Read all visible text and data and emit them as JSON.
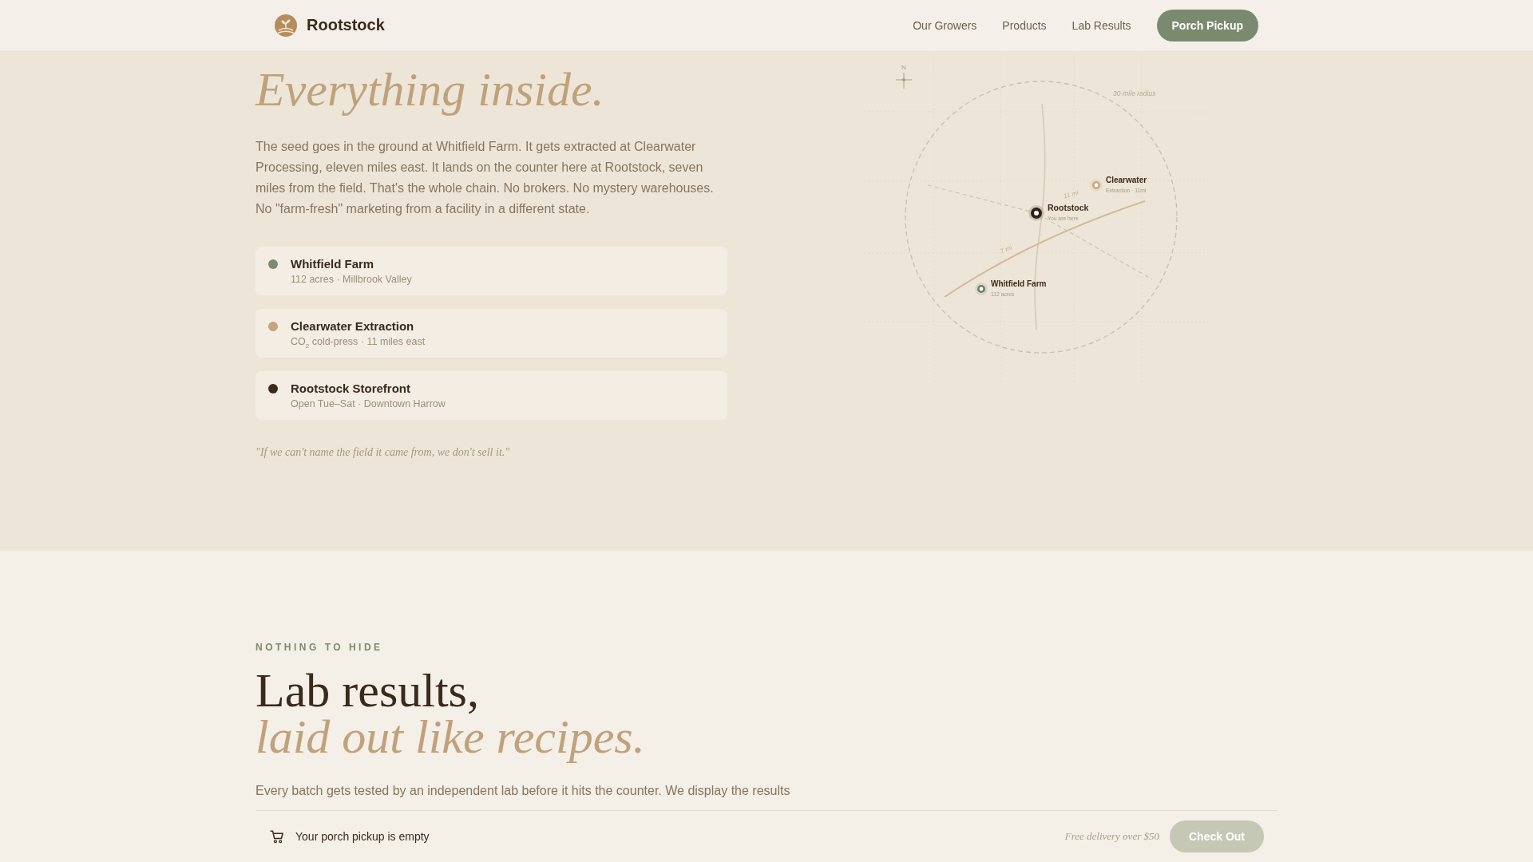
{
  "header": {
    "brand": "Rootstock",
    "nav": [
      {
        "label": "Our Growers"
      },
      {
        "label": "Products"
      },
      {
        "label": "Lab Results"
      }
    ],
    "cta": {
      "label": "Porch Pickup"
    }
  },
  "hero": {
    "title_accent": "Everything inside.",
    "body": "The seed goes in the ground at Whitfield Farm. It gets extracted at Clearwater Processing, eleven miles east. It lands on the counter here at Rootstock, seven miles from the field. That's the whole chain. No brokers. No mystery warehouses. No \"farm-fresh\" marketing from a facility in a different state.",
    "stops": [
      {
        "name": "Whitfield Farm",
        "detail": "112 acres · Millbrook Valley",
        "color": "#7b8b6f"
      },
      {
        "name": "Clearwater Extraction",
        "detail": "CO$_{2}$ cold-press · 11 miles east",
        "color": "#c4a57e"
      },
      {
        "name": "Rootstock Storefront",
        "detail": "Open Tue–Sat · Downtown Harrow",
        "color": "#3b2a1c"
      }
    ],
    "quote": "\"If we can't name the field it came from, we don't sell it.\"",
    "map": {
      "compass_label": "N",
      "radius_label": "30-mile radius",
      "distance_labels": [
        "11 mi",
        "7 mi"
      ],
      "sites": [
        {
          "kind": "processor",
          "name": "Clearwater",
          "detail": "Extraction · 11mi",
          "color": "#c9a87c"
        },
        {
          "kind": "store",
          "name": "Rootstock",
          "detail": "You are here",
          "color": "#2e2218"
        },
        {
          "kind": "farm",
          "name": "Whitfield Farm",
          "detail": "112 acres",
          "color": "#6e8266"
        }
      ]
    }
  },
  "lab_section": {
    "eyebrow": "NOTHING TO HIDE",
    "title": "Lab results,",
    "title_accent": "laid out like recipes.",
    "body": "Every batch gets tested by an independent lab before it hits the counter. We display the results"
  },
  "cart_bar": {
    "status": "Your porch pickup is empty",
    "note": "Free delivery over $50",
    "checkout": {
      "label": "Check Out",
      "disabled": true
    }
  }
}
